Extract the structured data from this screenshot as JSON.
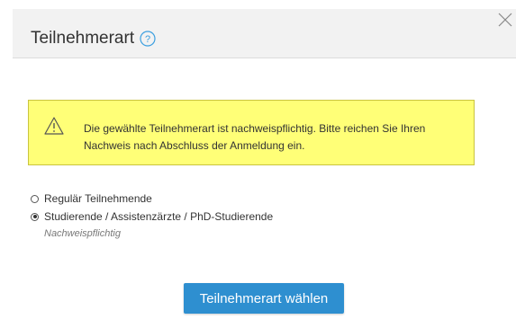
{
  "dialog": {
    "title": "Teilnehmerart",
    "help_icon": "help-circle-icon",
    "close_icon": "close-icon"
  },
  "alert": {
    "icon": "warning-triangle-icon",
    "message": "Die gewählte Teilnehmerart ist nachweispflichtig. Bitte reichen Sie Ihren Nachweis nach Abschluss der Anmeldung ein."
  },
  "options": [
    {
      "label": "Regulär Teilnehmende",
      "selected": false
    },
    {
      "label": "Studierende / Assistenzärzte / PhD-Studierende",
      "selected": true,
      "hint": "Nachweispflichtig"
    }
  ],
  "submit_label": "Teilnehmerart wählen",
  "colors": {
    "header_bg": "#f2f2f2",
    "alert_bg": "#ffff77",
    "primary": "#2e8fd0",
    "help_icon": "#3b9fe0"
  }
}
